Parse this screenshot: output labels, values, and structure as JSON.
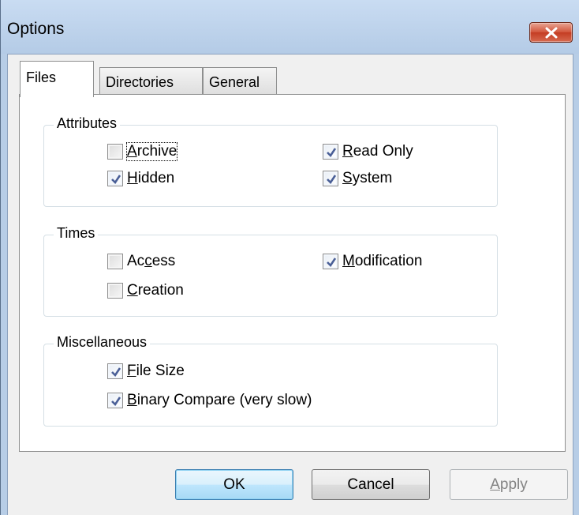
{
  "window": {
    "title": "Options"
  },
  "tabs": [
    {
      "label": "Files",
      "active": true
    },
    {
      "label": "Directories",
      "active": false
    },
    {
      "label": "General",
      "active": false
    }
  ],
  "groups": {
    "attributes": {
      "label": "Attributes",
      "items": [
        {
          "pre": "",
          "key": "A",
          "post": "rchive",
          "checked": false
        },
        {
          "pre": "",
          "key": "R",
          "post": "ead Only",
          "checked": true
        },
        {
          "pre": "",
          "key": "H",
          "post": "idden",
          "checked": true
        },
        {
          "pre": "",
          "key": "S",
          "post": "ystem",
          "checked": true
        }
      ]
    },
    "times": {
      "label": "Times",
      "items": [
        {
          "pre": "Ac",
          "key": "c",
          "post": "ess",
          "checked": false
        },
        {
          "pre": "",
          "key": "M",
          "post": "odification",
          "checked": true
        },
        {
          "pre": "",
          "key": "C",
          "post": "reation",
          "checked": false
        }
      ]
    },
    "misc": {
      "label": "Miscellaneous",
      "items": [
        {
          "pre": "",
          "key": "F",
          "post": "ile Size",
          "checked": true
        },
        {
          "pre": "",
          "key": "B",
          "post": "inary Compare (very slow)",
          "checked": true
        }
      ]
    }
  },
  "buttons": {
    "ok": "OK",
    "cancel": "Cancel",
    "apply_key": "A",
    "apply_rest": "pply"
  },
  "colors": {
    "titlebar": "#b7cde6",
    "close_button": "#c43c22",
    "checkmark": "#4a5f97"
  }
}
